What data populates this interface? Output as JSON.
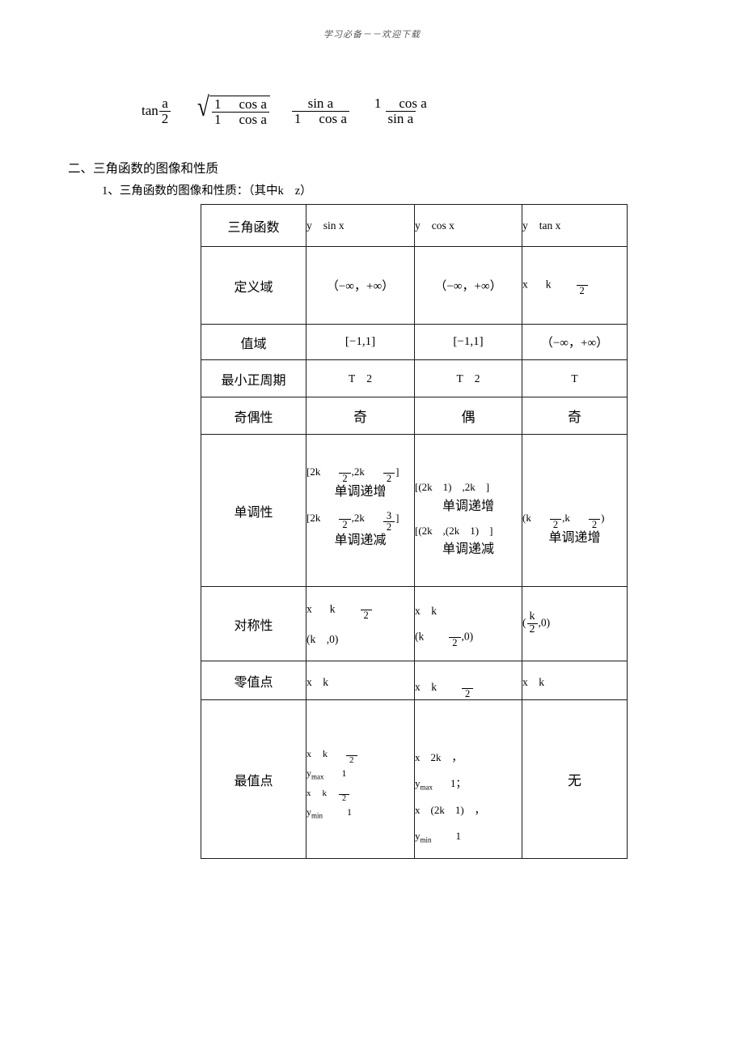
{
  "header": {
    "running_head": "学习必备－－欢迎下载"
  },
  "formula": {
    "lhs_fn": "tan",
    "lhs_num": "a",
    "lhs_den": "2",
    "rad_num_1": "1",
    "rad_num_2": "cos a",
    "rad_den_1": "1",
    "rad_den_2": "cos a",
    "f2_num_1": "sin a",
    "f2_den_1": "1",
    "f2_den_2": "cos a",
    "f3_num_1": "1",
    "f3_num_2": "cos a",
    "f3_den_1": "sin a"
  },
  "headings": {
    "section": "二、三角函数的图像和性质",
    "subsection_a": "1、三角函数的图像和性质：（其中k",
    "subsection_b": "z）"
  },
  "table": {
    "header": {
      "label": "三角函数",
      "sin": {
        "y": "y",
        "f": "sin x"
      },
      "cos": {
        "y": "y",
        "f": "cos x"
      },
      "tan": {
        "y": "y",
        "f": "tan x"
      }
    },
    "rows": [
      {
        "label": "定义域",
        "sin": "（−∞，+∞）",
        "cos": "（−∞，+∞）",
        "tan_x": "x",
        "tan_k": "k",
        "tan_den": "2"
      },
      {
        "label": "值域",
        "sin": "[−1,1]",
        "cos": "[−1,1]",
        "tan": "（−∞，+∞）"
      },
      {
        "label": "最小正周期",
        "sin_t": "T",
        "sin_v": "2",
        "cos_t": "T",
        "cos_v": "2",
        "tan_t": "T"
      },
      {
        "label": "奇偶性",
        "sin": "奇",
        "cos": "偶",
        "tan": "奇"
      },
      {
        "label": "单调性",
        "sin_inc_a": "[2k",
        "sin_inc_den1": "2",
        "sin_inc_b": ",2k",
        "sin_inc_den2": "2",
        "sin_inc_c": "]",
        "sin_inc_zh": "单调递增",
        "sin_dec_a": "[2k",
        "sin_dec_den1": "2",
        "sin_dec_b": ",2k",
        "sin_dec_num2": "3",
        "sin_dec_den2": "2",
        "sin_dec_c": "]",
        "sin_dec_zh": "单调递减",
        "cos_inc": "[(2k　1)　,2k　]",
        "cos_inc_zh": "单调递增",
        "cos_dec": "[(2k　,(2k　1)　]",
        "cos_dec_zh": "单调递减",
        "tan_a": "(k",
        "tan_den1": "2",
        "tan_b": ",k",
        "tan_den2": "2",
        "tan_c": ")",
        "tan_zh": "单调递增"
      },
      {
        "label": "对称性",
        "sin_l1_x": "x",
        "sin_l1_k": "k",
        "sin_l1_den": "2",
        "sin_l2": "(k　,0)",
        "cos_l1": "x　k",
        "cos_l2_a": "(k",
        "cos_l2_den": "2",
        "cos_l2_b": ",0)",
        "tan_a": "(",
        "tan_num": "k",
        "tan_den": "2",
        "tan_b": ",0)"
      },
      {
        "label": "零值点",
        "sin": "x　k",
        "cos_a": "x　k",
        "cos_den": "2",
        "tan": "x　k"
      },
      {
        "label": "最值点",
        "sin_l1_x": "x",
        "sin_l1_k": "k",
        "sin_l1_den": "2",
        "sin_l2_y": "y",
        "sin_l2_sub": "max",
        "sin_l2_v": "1",
        "sin_l3_x": "x",
        "sin_l3_k": "k",
        "sin_l3_den": "2",
        "sin_l4_y": "y",
        "sin_l4_sub": "min",
        "sin_l4_v": "1",
        "cos_l1": "x　2k　，",
        "cos_l2_y": "y",
        "cos_l2_sub": "max",
        "cos_l2_v": "1；",
        "cos_l3": "x　(2k　1)　，",
        "cos_l4_y": "y",
        "cos_l4_sub": "min",
        "cos_l4_v": "1",
        "tan": "无"
      }
    ]
  }
}
